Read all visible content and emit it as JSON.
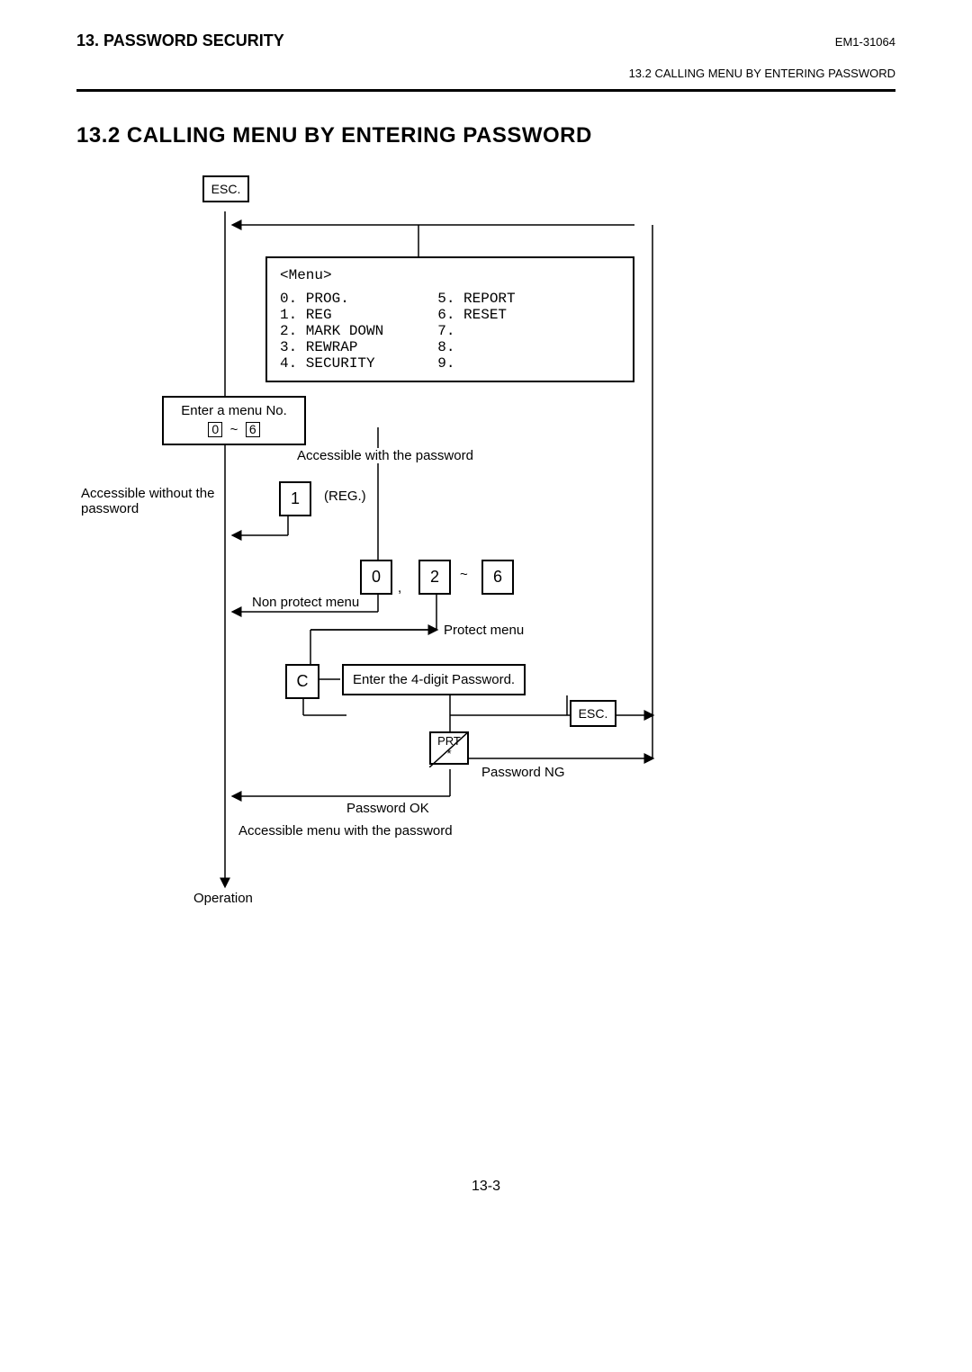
{
  "header": {
    "chapter": "13. PASSWORD SECURITY",
    "doc_id": "EM1-31064",
    "subsection": "13.2 CALLING MENU BY ENTERING PASSWORD"
  },
  "section_title": "13.2  CALLING MENU BY ENTERING PASSWORD",
  "diagram": {
    "esc_top": "ESC.",
    "menu_panel_title": "<Menu>",
    "menu_left": "0. PROG.\n1. REG\n2. MARK DOWN\n3. REWRAP\n4. SECURITY",
    "menu_right": "5. REPORT\n6. RESET\n7.\n8.\n9.",
    "enter_menu_no": "Enter a menu No.",
    "range_lo": "0",
    "range_sep": "~",
    "range_hi": "6",
    "accessible_with_pw": "Accessible with the password",
    "accessible_without_pw": "Accessible without the\npassword",
    "reg_key": "1",
    "reg_label": "(REG.)",
    "zero_key": "0",
    "comma": ",",
    "two_key": "2",
    "tilde": "~",
    "six_key": "6",
    "non_protect": "Non protect menu",
    "protect_menu": "Protect menu",
    "c_key": "C",
    "enter_pw": "Enter the 4-digit Password.",
    "esc_key": "ESC.",
    "prt_key": "PRT\n*",
    "pw_ok": "Password OK",
    "pw_ng": "Password NG",
    "accessible_menu_pw": "Accessible menu with the password",
    "operation": "Operation"
  },
  "page_number": "13-3"
}
